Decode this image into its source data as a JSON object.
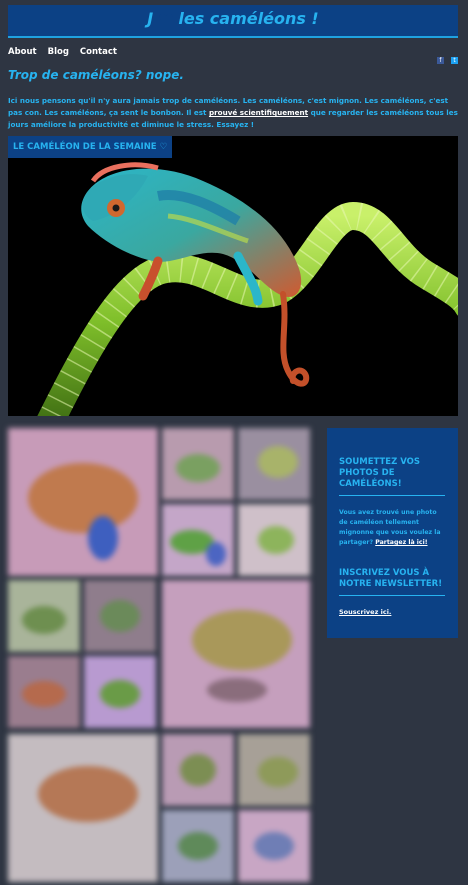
{
  "header": {
    "title_start": "J",
    "title_end": "les caméléons !"
  },
  "nav": {
    "items": [
      "About",
      "Blog",
      "Contact"
    ]
  },
  "social": {
    "icons": [
      "facebook-icon",
      "twitter-icon"
    ]
  },
  "tagline": "Trop de caméléons? nope.",
  "intro": {
    "text_before": "Ici nous pensons qu'il n'y aura jamais trop de caméléons. Les caméléons, c'est mignon. Les caméléons, c'est pas con. Les caméléons, ça sent le bonbon. Il est ",
    "link": "prouvé scientifiquement",
    "text_after": " que regarder les caméléons tous les jours améliore la productivité et diminue le stress. Essayez !"
  },
  "feature": {
    "label": "LE CAMÉLÉON DE LA SEMAINE ♡"
  },
  "sidebar": {
    "submit_heading": "SOUMETTEZ VOS PHOTOS DE CAMÉLÉONS!",
    "submit_text": "Vous avez trouvé une photo de caméléon tellement mignonne que vous voulez la partager? ",
    "submit_link": "Partagez là ici!",
    "newsletter_heading": "INSCRIVEZ VOUS À NOTRE NEWSLETTER!",
    "newsletter_link": "Souscrivez ici."
  },
  "colors": {
    "accent": "#27b3f0",
    "brand": "#0c4185",
    "background": "#2e3542"
  }
}
